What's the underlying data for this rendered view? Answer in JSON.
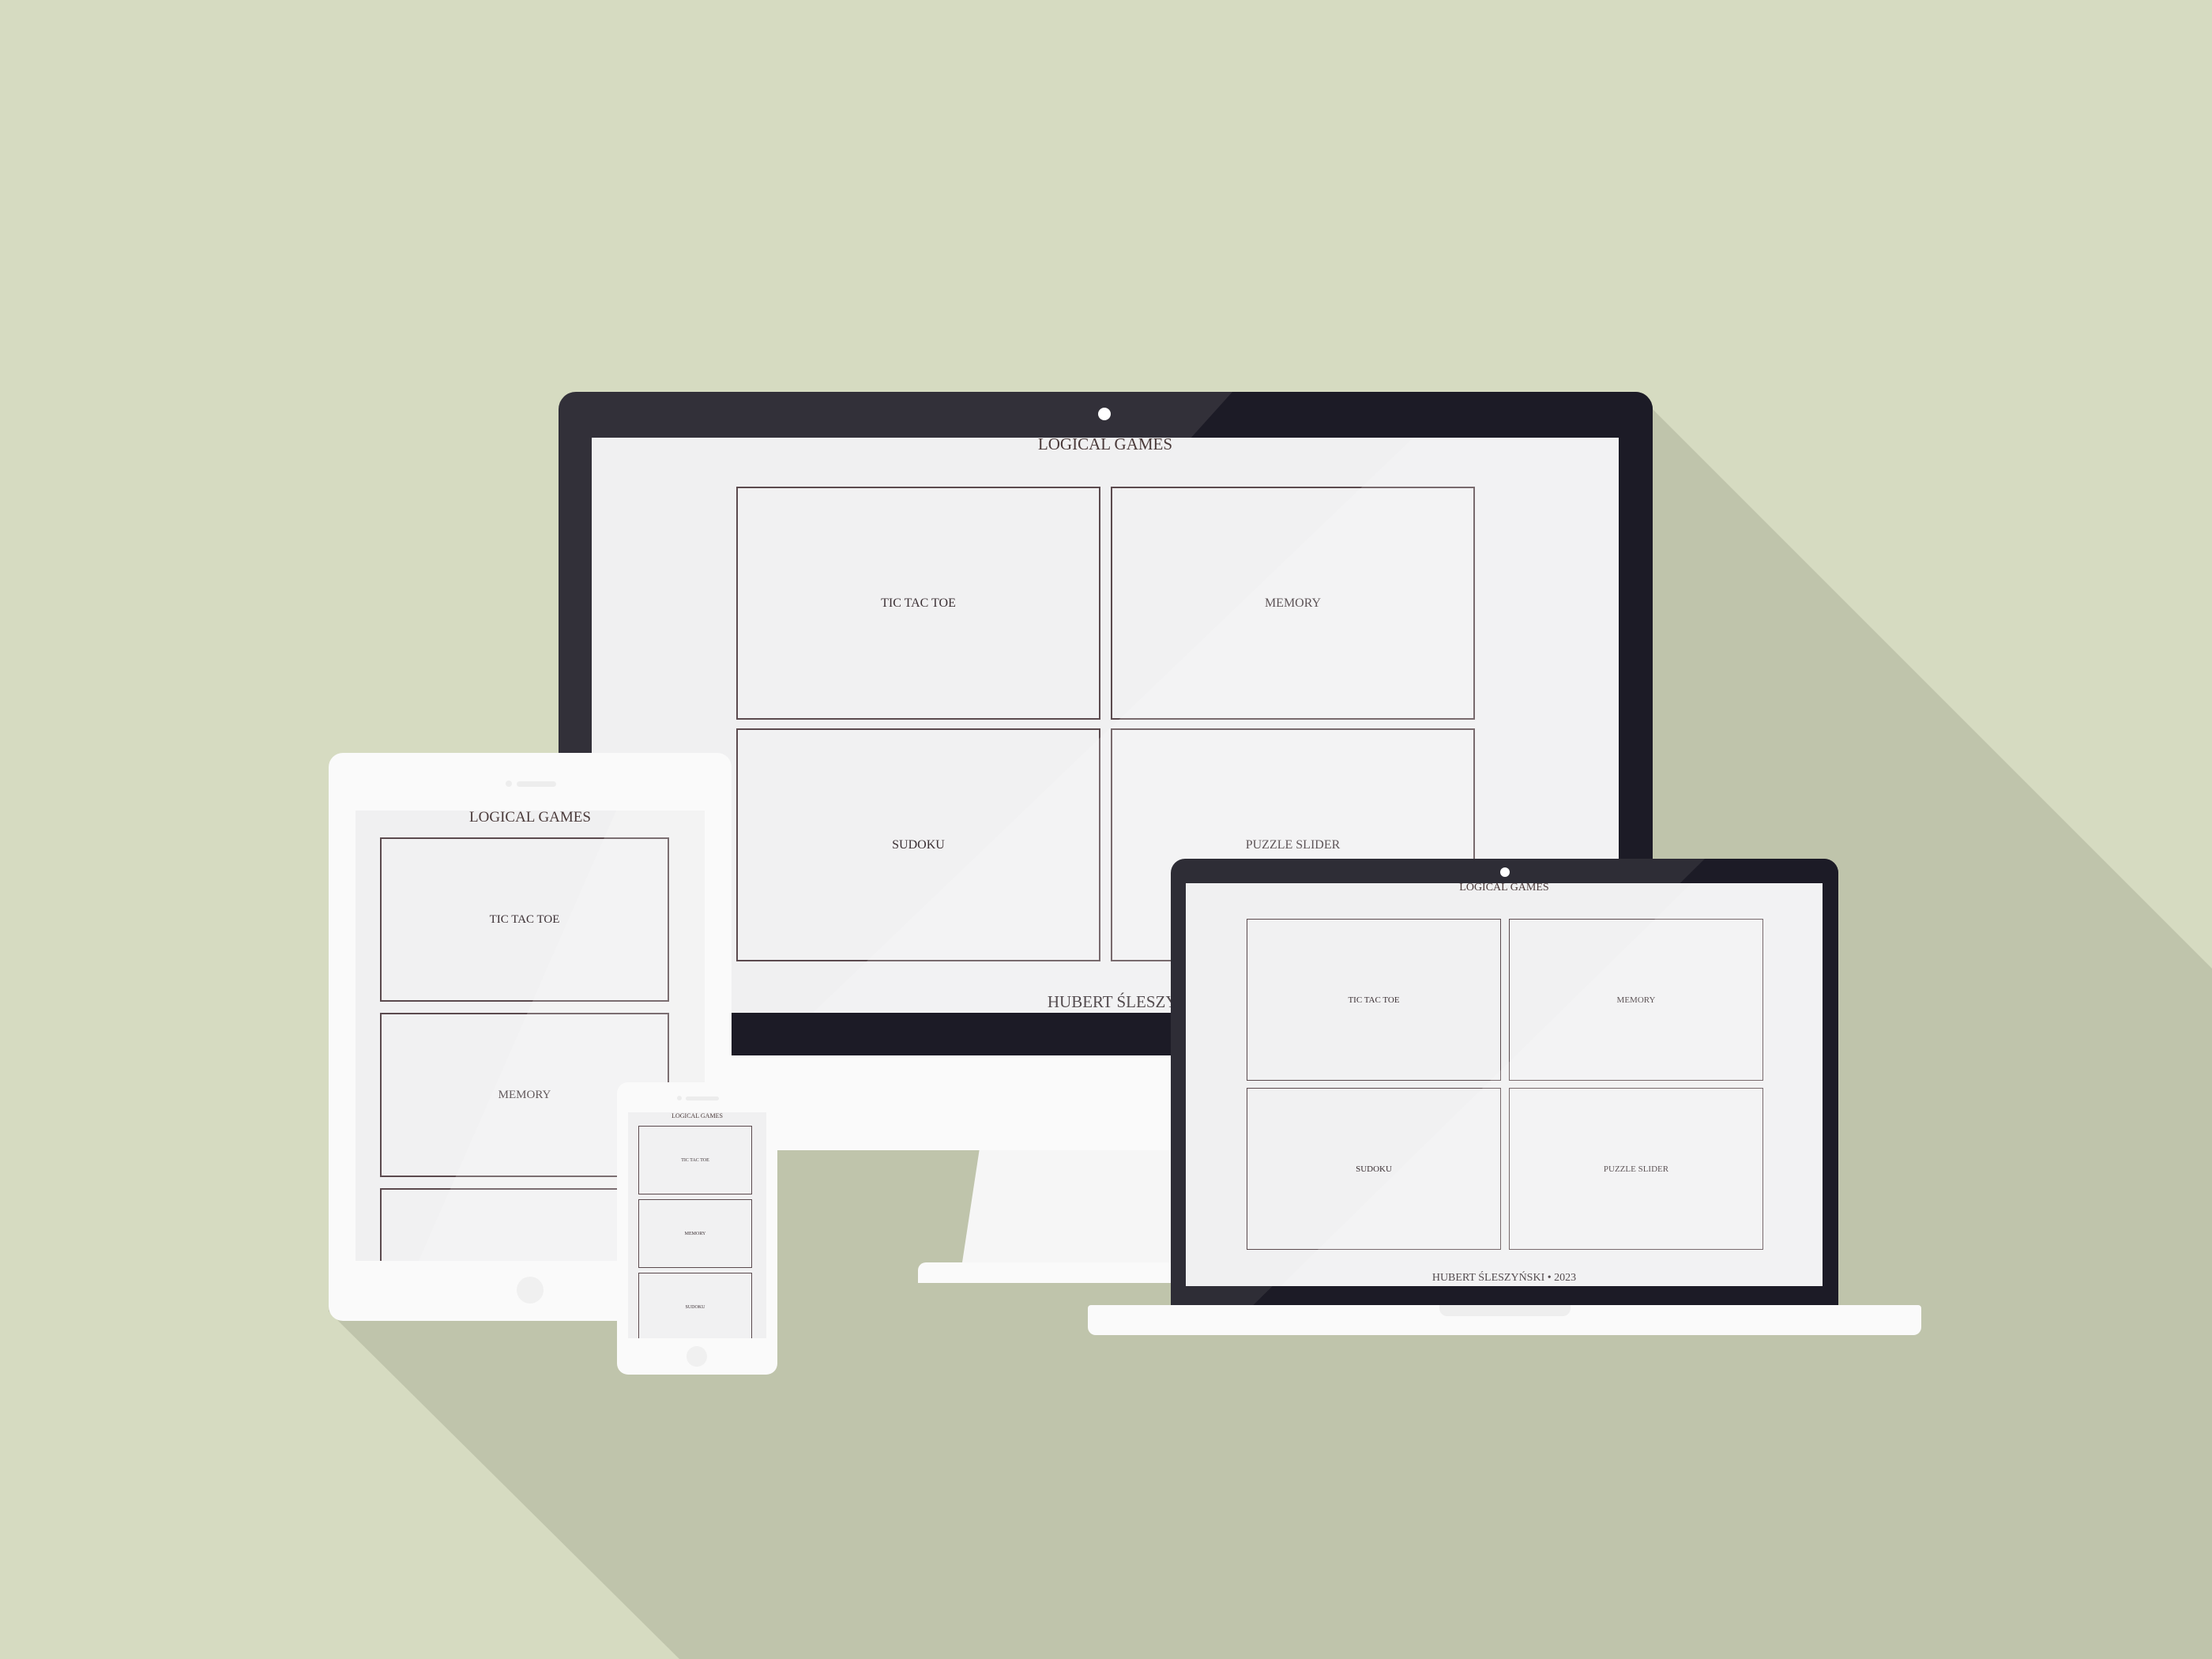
{
  "scene": {
    "background_color": "#d6dbc1",
    "shadow_color": "#bfc4ab",
    "device_frame_dark": "#323039",
    "device_frame_light": "#fafafa",
    "screen_bg": "#f0f0f1",
    "card_border": "#5b4a4e"
  },
  "monitor": {
    "title": "LOGICAL GAMES",
    "cards": [
      "TIC TAC TOE",
      "MEMORY",
      "SUDOKU",
      "PUZZLE SLIDER"
    ],
    "footer": "HUBERT ŚLESZYŃSKI •"
  },
  "laptop": {
    "title": "LOGICAL GAMES",
    "cards": [
      "TIC TAC TOE",
      "MEMORY",
      "SUDOKU",
      "PUZZLE SLIDER"
    ],
    "footer": "HUBERT ŚLESZYŃSKI • 2023"
  },
  "tablet": {
    "title": "LOGICAL GAMES",
    "cards": [
      "TIC TAC TOE",
      "MEMORY",
      ""
    ]
  },
  "phone": {
    "title": "LOGICAL GAMES",
    "cards": [
      "TIC TAC TOE",
      "MEMORY",
      "SUDOKU"
    ]
  }
}
